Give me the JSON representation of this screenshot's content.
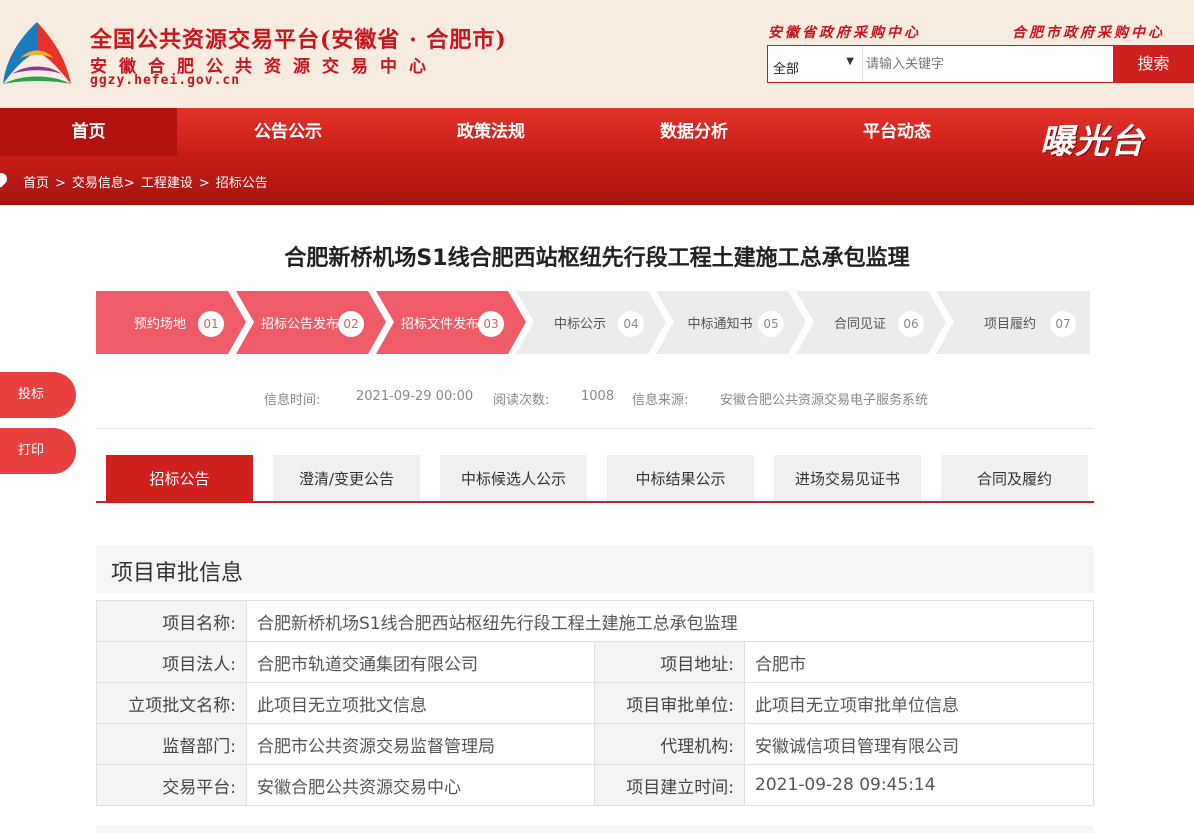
{
  "header": {
    "title": "全国公共资源交易平台(安徽省 · 合肥市)",
    "subtitle": "安徽合肥公共资源交易中心",
    "url": "ggzy.hefei.gov.cn",
    "links": [
      "安徽省政府采购中心",
      "合肥市政府采购中心"
    ],
    "search": {
      "selected": "全部",
      "placeholder": "请输入关键字",
      "button": "搜索"
    }
  },
  "nav": {
    "items": [
      "首页",
      "公告公示",
      "政策法规",
      "数据分析",
      "平台动态"
    ],
    "active": "首页",
    "logo_text": "曝光台"
  },
  "breadcrumb": [
    "首页",
    ">",
    "交易信息>",
    "工程建设",
    ">",
    "招标公告"
  ],
  "page_title": "合肥新桥机场S1线合肥西站枢纽先行段工程土建施工总承包监理",
  "steps": [
    {
      "label": "预约场地",
      "num": "01",
      "done": true
    },
    {
      "label": "招标公告发布",
      "num": "02",
      "done": true
    },
    {
      "label": "招标文件发布",
      "num": "03",
      "done": true
    },
    {
      "label": "中标公示",
      "num": "04",
      "done": false
    },
    {
      "label": "中标通知书",
      "num": "05",
      "done": false
    },
    {
      "label": "合同见证",
      "num": "06",
      "done": false
    },
    {
      "label": "项目履约",
      "num": "07",
      "done": false
    }
  ],
  "side_buttons": [
    "投标",
    "打印"
  ],
  "meta": {
    "time_label": "信息时间:",
    "time": "2021-09-29 00:00",
    "views_label": "阅读次数:",
    "views": "1008",
    "source_label": "信息来源:",
    "source": "安徽合肥公共资源交易电子服务系统"
  },
  "tabs": [
    "招标公告",
    "澄清/变更公告",
    "中标候选人公示",
    "中标结果公示",
    "进场交易见证书",
    "合同及履约"
  ],
  "active_tab": "招标公告",
  "section_title": "项目审批信息",
  "info": {
    "name_label": "项目名称:",
    "name": "合肥新桥机场S1线合肥西站枢纽先行段工程土建施工总承包监理",
    "legal_label": "项目法人:",
    "legal": "合肥市轨道交通集团有限公司",
    "address_label": "项目地址:",
    "address": "合肥市",
    "approval_doc_label": "立项批文名称:",
    "approval_doc": "此项目无立项批文信息",
    "approval_unit_label": "项目审批单位:",
    "approval_unit": "此项目无立项审批单位信息",
    "supervisor_label": "监督部门:",
    "supervisor": "合肥市公共资源交易监督管理局",
    "agency_label": "代理机构:",
    "agency": "安徽诚信项目管理有限公司",
    "platform_label": "交易平台:",
    "platform": "安徽合肥公共资源交易中心",
    "created_label": "项目建立时间:",
    "created": "2021-09-28 09:45:14"
  },
  "colors": {
    "brand_red": "#d0201e",
    "step_done": "#ef5b67",
    "step_todo": "#ececec"
  }
}
